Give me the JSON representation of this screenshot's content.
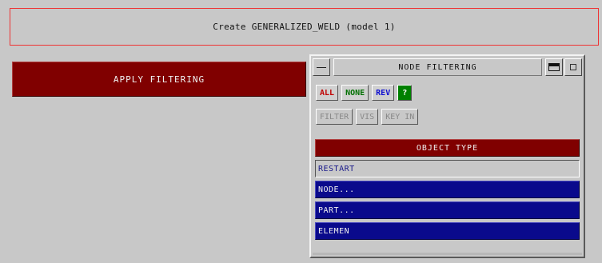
{
  "window": {
    "title": "Create GENERALIZED_WELD (model 1)"
  },
  "apply_filtering": {
    "label": "APPLY FILTERING"
  },
  "node_filtering": {
    "title": "NODE FILTERING",
    "toolbar": {
      "all_label": "ALL",
      "none_label": "NONE",
      "rev_label": "REV",
      "help_label": "?"
    },
    "options": {
      "filter_label": "FILTER",
      "vis_label": "VIS",
      "keyin_label": "KEY IN"
    },
    "object_type_label": "OBJECT TYPE",
    "items": [
      {
        "label": "RESTART",
        "style": "light"
      },
      {
        "label": "NODE...",
        "style": "dark"
      },
      {
        "label": "PART...",
        "style": "dark"
      },
      {
        "label": "ELEMEN",
        "style": "dark"
      }
    ]
  },
  "colors": {
    "accent_red": "#800000",
    "list_blue": "#0a0a8c",
    "panel_grey": "#c8c8c8",
    "title_border": "#ee3333"
  },
  "icons": [
    "minimize-icon",
    "maximize-icon",
    "restore-icon"
  ]
}
